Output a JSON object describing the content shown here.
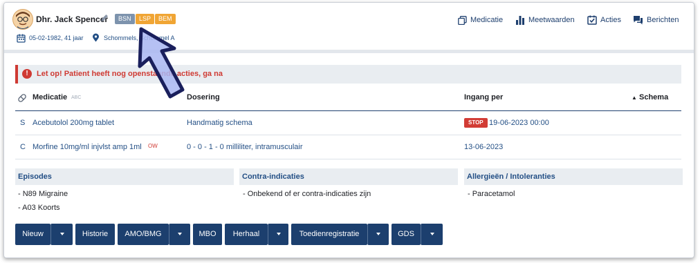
{
  "patient": {
    "name": "Dhr. Jack Spencer",
    "badges": [
      "BSN",
      "LSP",
      "BEM"
    ],
    "dob": "05-02-1982, 41 jaar",
    "location": "Schommels, Schommel A"
  },
  "nav": {
    "medicatie": "Medicatie",
    "meetwaarden": "Meetwaarden",
    "acties": "Acties",
    "berichten": "Berichten"
  },
  "alert": {
    "text": "Let op!  Patient heeft nog openstaande acties, ga na"
  },
  "table": {
    "headers": {
      "medicatie": "Medicatie",
      "medicatie_sub": "ABC",
      "dosering": "Dosering",
      "ingang": "Ingang per",
      "schema": "Schema"
    },
    "rows": [
      {
        "type": "S",
        "name": "Acebutolol 200mg tablet",
        "flag": "",
        "dosage": "Handmatig schema",
        "status": "STOP",
        "start": "19-06-2023 00:00"
      },
      {
        "type": "C",
        "name": "Morfine 10mg/ml injvlst amp 1ml",
        "flag": "OW",
        "dosage": "0 - 0 - 1 - 0 milliliter, intramusculair",
        "status": "",
        "start": "13-06-2023"
      }
    ]
  },
  "panels": {
    "episodes": {
      "title": "Episodes",
      "items": [
        "- N89 Migraine",
        "- A03 Koorts"
      ]
    },
    "contra": {
      "title": "Contra-indicaties",
      "items": [
        "- Onbekend of er contra-indicaties zijn"
      ]
    },
    "allergies": {
      "title": "Allergieën / Intoleranties",
      "items": [
        "- Paracetamol"
      ]
    }
  },
  "buttons": {
    "nieuw": "Nieuw",
    "historie": "Historie",
    "amo": "AMO/BMG",
    "mbo": "MBO",
    "herhaal": "Herhaal",
    "toedien": "Toedienregistratie",
    "gds": "GDS"
  },
  "colors": {
    "primary": "#1c3f6e",
    "link": "#234f85",
    "danger": "#cf3a33",
    "warning": "#f0a534",
    "muted_badge": "#7d93ad",
    "cursor": "#a9b6f2"
  }
}
